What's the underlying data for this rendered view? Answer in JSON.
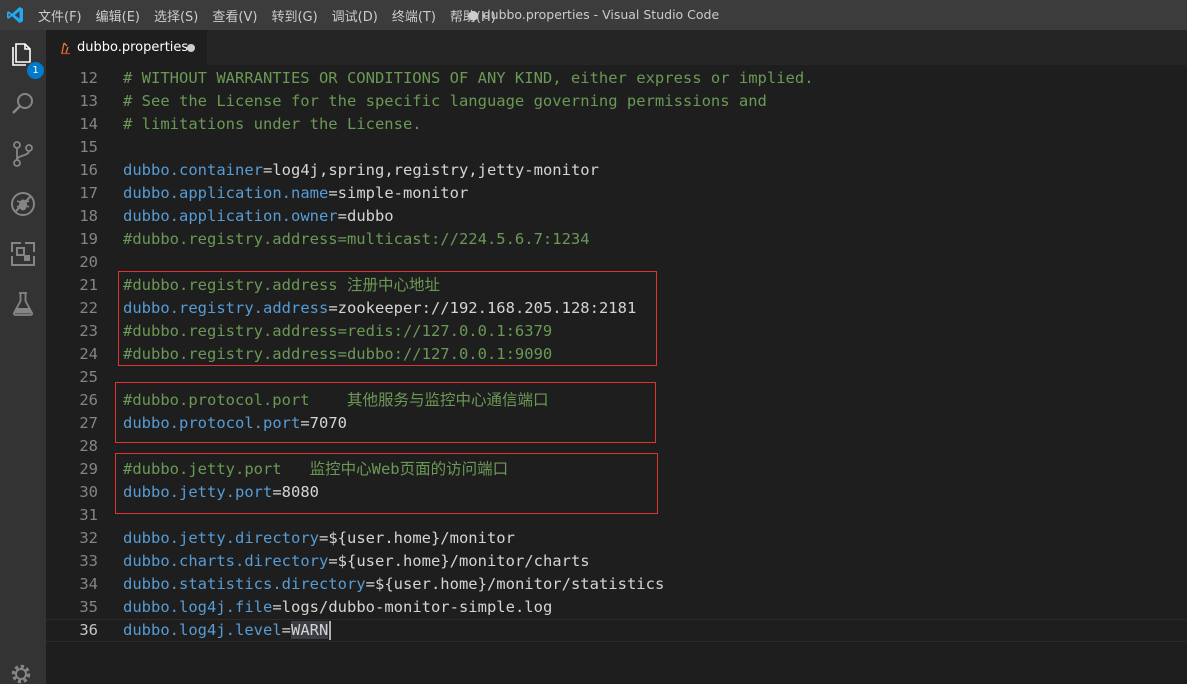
{
  "titlebar": {
    "menu": [
      "文件(F)",
      "编辑(E)",
      "选择(S)",
      "查看(V)",
      "转到(G)",
      "调试(D)",
      "终端(T)",
      "帮助(H)"
    ],
    "window_title": "● dubbo.properties - Visual Studio Code"
  },
  "activitybar": {
    "icons": [
      "explorer-icon",
      "search-icon",
      "source-control-icon",
      "debug-icon",
      "extensions-icon",
      "test-flask-icon",
      "gear-icon"
    ],
    "explorer_badge": "1"
  },
  "tab": {
    "label": "dubbo.properties",
    "dirty": true
  },
  "editor": {
    "lines": [
      {
        "n": "12",
        "k1": "",
        "k2": "",
        "eq": "",
        "v": "",
        "comment": "# WITHOUT WARRANTIES OR CONDITIONS OF ANY KIND, either express or implied."
      },
      {
        "n": "13",
        "k1": "",
        "k2": "",
        "eq": "",
        "v": "",
        "comment": "# See the License for the specific language governing permissions and"
      },
      {
        "n": "14",
        "k1": "",
        "k2": "",
        "eq": "",
        "v": "",
        "comment": "# limitations under the License."
      },
      {
        "n": "15",
        "k1": "",
        "k2": "",
        "eq": "",
        "v": "",
        "comment": ""
      },
      {
        "n": "16",
        "k1": "dubbo.",
        "k2": "container",
        "eq": "=",
        "v": "log4j,spring,registry,jetty-monitor",
        "comment": ""
      },
      {
        "n": "17",
        "k1": "dubbo.",
        "k2": "application.name",
        "eq": "=",
        "v": "simple-monitor",
        "comment": ""
      },
      {
        "n": "18",
        "k1": "dubbo.",
        "k2": "application.owner",
        "eq": "=",
        "v": "dubbo",
        "comment": ""
      },
      {
        "n": "19",
        "k1": "",
        "k2": "",
        "eq": "",
        "v": "",
        "comment": "#dubbo.registry.address=multicast://224.5.6.7:1234"
      },
      {
        "n": "20",
        "k1": "",
        "k2": "",
        "eq": "",
        "v": "",
        "comment": ""
      },
      {
        "n": "21",
        "k1": "",
        "k2": "",
        "eq": "",
        "v": "",
        "comment": "#dubbo.registry.address 注册中心地址"
      },
      {
        "n": "22",
        "k1": "dubbo.",
        "k2": "registry.address",
        "eq": "=",
        "v": "zookeeper://192.168.205.128:2181",
        "comment": ""
      },
      {
        "n": "23",
        "k1": "",
        "k2": "",
        "eq": "",
        "v": "",
        "comment": "#dubbo.registry.address=redis://127.0.0.1:6379"
      },
      {
        "n": "24",
        "k1": "",
        "k2": "",
        "eq": "",
        "v": "",
        "comment": "#dubbo.registry.address=dubbo://127.0.0.1:9090"
      },
      {
        "n": "25",
        "k1": "",
        "k2": "",
        "eq": "",
        "v": "",
        "comment": ""
      },
      {
        "n": "26",
        "k1": "",
        "k2": "",
        "eq": "",
        "v": "",
        "comment": "#dubbo.protocol.port    其他服务与监控中心通信端口"
      },
      {
        "n": "27",
        "k1": "dubbo.",
        "k2": "protocol.port",
        "eq": "=",
        "v": "7070",
        "comment": ""
      },
      {
        "n": "28",
        "k1": "",
        "k2": "",
        "eq": "",
        "v": "",
        "comment": ""
      },
      {
        "n": "29",
        "k1": "",
        "k2": "",
        "eq": "",
        "v": "",
        "comment": "#dubbo.jetty.port   监控中心Web页面的访问端口"
      },
      {
        "n": "30",
        "k1": "dubbo.",
        "k2": "jetty.port",
        "eq": "=",
        "v": "8080",
        "comment": ""
      },
      {
        "n": "31",
        "k1": "",
        "k2": "",
        "eq": "",
        "v": "",
        "comment": ""
      },
      {
        "n": "32",
        "k1": "dubbo.",
        "k2": "jetty.directory",
        "eq": "=",
        "v": "${user.home}/monitor",
        "comment": ""
      },
      {
        "n": "33",
        "k1": "dubbo.",
        "k2": "charts.directory",
        "eq": "=",
        "v": "${user.home}/monitor/charts",
        "comment": ""
      },
      {
        "n": "34",
        "k1": "dubbo.",
        "k2": "statistics.directory",
        "eq": "=",
        "v": "${user.home}/monitor/statistics",
        "comment": ""
      },
      {
        "n": "35",
        "k1": "dubbo.",
        "k2": "log4j.file",
        "eq": "=",
        "v": "logs/dubbo-monitor-simple.log",
        "comment": ""
      },
      {
        "n": "36",
        "k1": "dubbo.",
        "k2": "log4j.level",
        "eq": "=",
        "v": "WARN",
        "comment": ""
      }
    ],
    "current_line": "36",
    "highlight_boxes": [
      "registry-address-box",
      "protocol-port-box",
      "jetty-port-box"
    ]
  },
  "colors": {
    "background": "#1e1e1e",
    "comment": "#6a9955",
    "key": "#569cd6",
    "text": "#d4d4d4",
    "annotation_box": "#e0352e",
    "badge": "#007acc"
  }
}
